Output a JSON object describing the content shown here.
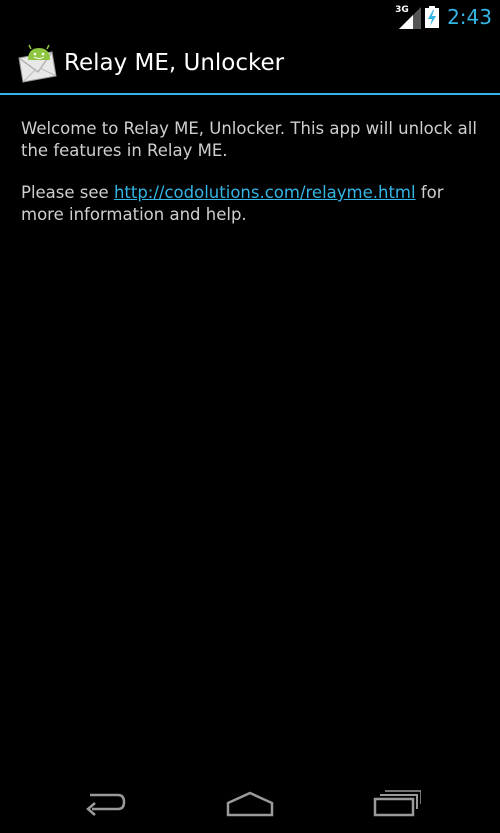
{
  "status_bar": {
    "network_type": "3G",
    "time": "2:43",
    "signal_icon": "cell-signal-icon",
    "battery_icon": "battery-charging-icon"
  },
  "action_bar": {
    "app_icon": "relay-me-envelope-icon",
    "title": "Relay ME, Unlocker"
  },
  "content": {
    "welcome_text": "Welcome to Relay ME, Unlocker. This app will unlock all the features in Relay ME.",
    "info_prefix": "Please see ",
    "info_link": "http://codolutions.com/relayme.html",
    "info_suffix": " for more information and help."
  },
  "nav_bar": {
    "back_icon": "back-icon",
    "home_icon": "home-icon",
    "recents_icon": "recent-apps-icon"
  },
  "colors": {
    "accent": "#33b5e5",
    "background": "#000000",
    "text": "#cfcfcf",
    "title": "#ffffff"
  }
}
